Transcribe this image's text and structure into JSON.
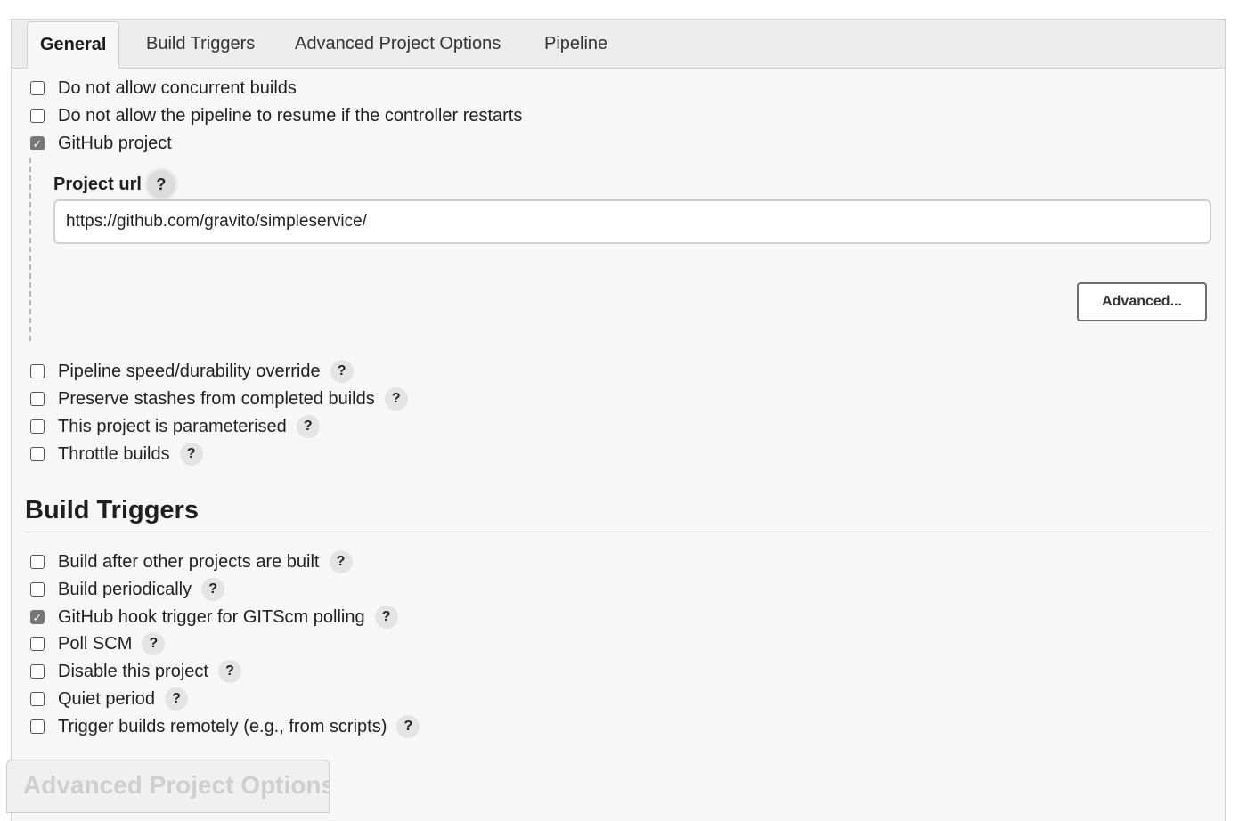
{
  "tabs": [
    {
      "label": "General",
      "active": true
    },
    {
      "label": "Build Triggers",
      "active": false
    },
    {
      "label": "Advanced Project Options",
      "active": false
    },
    {
      "label": "Pipeline",
      "active": false
    }
  ],
  "general": {
    "options_top": [
      {
        "label": "Do not allow concurrent builds",
        "checked": false
      },
      {
        "label": "Do not allow the pipeline to resume if the controller restarts",
        "checked": false
      },
      {
        "label": "GitHub project",
        "checked": true
      }
    ],
    "project_url": {
      "label": "Project url",
      "value": "https://github.com/gravito/simpleservice/",
      "help": "?"
    },
    "advanced_button": "Advanced...",
    "options_bottom": [
      {
        "label": "Pipeline speed/durability override",
        "checked": false,
        "help": "?"
      },
      {
        "label": "Preserve stashes from completed builds",
        "checked": false,
        "help": "?"
      },
      {
        "label": "This project is parameterised",
        "checked": false,
        "help": "?"
      },
      {
        "label": "Throttle builds",
        "checked": false,
        "help": "?"
      }
    ]
  },
  "build_triggers": {
    "heading": "Build Triggers",
    "options": [
      {
        "label": "Build after other projects are built",
        "checked": false,
        "help": "?"
      },
      {
        "label": "Build periodically",
        "checked": false,
        "help": "?"
      },
      {
        "label": "GitHub hook trigger for GITScm polling",
        "checked": true,
        "help": "?"
      },
      {
        "label": "Poll SCM",
        "checked": false,
        "help": "?"
      },
      {
        "label": "Disable this project",
        "checked": false,
        "help": "?"
      },
      {
        "label": "Quiet period",
        "checked": false,
        "help": "?"
      },
      {
        "label": "Trigger builds remotely (e.g., from scripts)",
        "checked": false,
        "help": "?"
      }
    ]
  },
  "next_section_heading": "Advanced Project Options",
  "colors": {
    "checkbox_checked": "#777777",
    "help_bubble": "#e4e4e4",
    "panel_background": "#f7f7f7"
  }
}
